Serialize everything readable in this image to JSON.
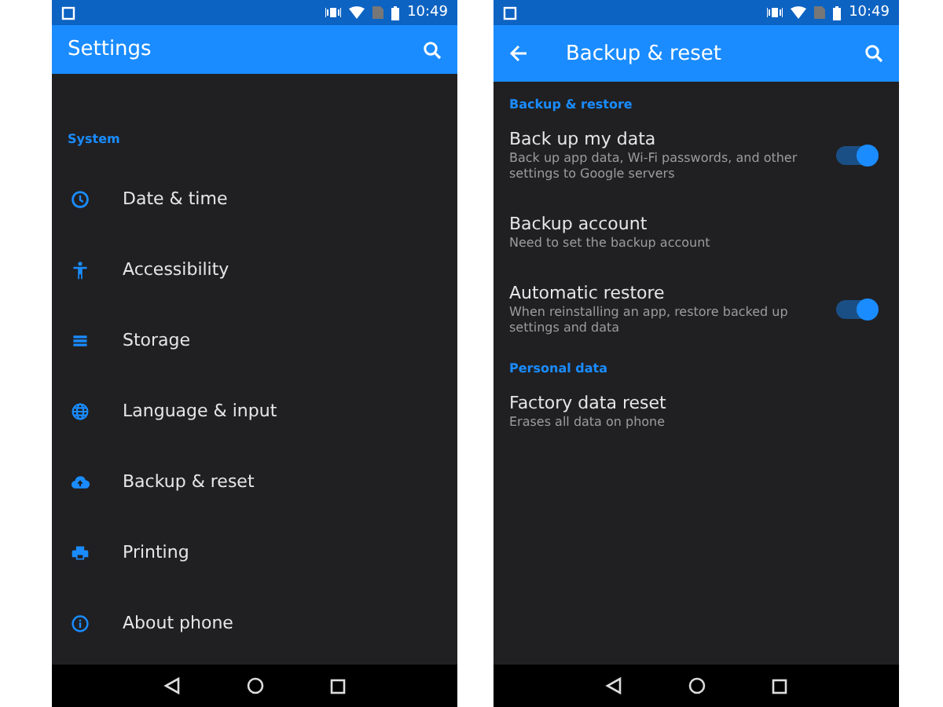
{
  "phones": [
    {
      "status_bar": {
        "time": "10:49"
      },
      "app_bar": {
        "title": "Settings",
        "back": false
      },
      "sections": [
        {
          "header": "System",
          "items": [
            {
              "kind": "plain",
              "title": "Date & time"
            },
            {
              "kind": "plain",
              "title": "Accessibility"
            },
            {
              "kind": "plain",
              "title": "Storage"
            },
            {
              "kind": "plain",
              "title": "Language & input"
            },
            {
              "kind": "plain",
              "title": "Backup & reset"
            },
            {
              "kind": "plain",
              "title": "Printing"
            },
            {
              "kind": "plain",
              "title": "About phone"
            }
          ]
        }
      ]
    },
    {
      "status_bar": {
        "time": "10:49"
      },
      "app_bar": {
        "title": "Backup & reset",
        "back": true
      },
      "sections": [
        {
          "header": "Backup & restore",
          "items": [
            {
              "kind": "toggle",
              "on": true,
              "title": "Back up my data",
              "subtitle": "Back up app data, Wi-Fi passwords, and other settings to Google servers"
            },
            {
              "kind": "plain",
              "title": "Backup account",
              "subtitle": "Need to set the backup account"
            },
            {
              "kind": "toggle",
              "on": true,
              "title": "Automatic restore",
              "subtitle": "When reinstalling an app, restore backed up settings and data"
            }
          ]
        },
        {
          "header": "Personal data",
          "items": [
            {
              "kind": "plain",
              "title": "Factory data reset",
              "subtitle": "Erases all data on phone"
            }
          ]
        }
      ]
    }
  ]
}
